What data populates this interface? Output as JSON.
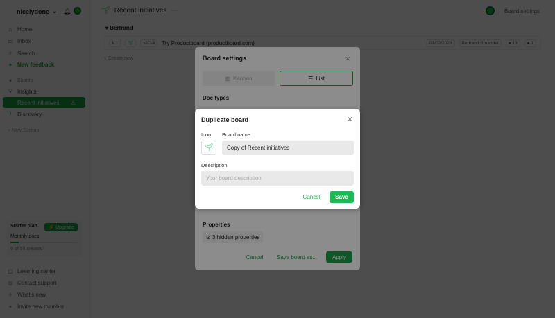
{
  "sidebar": {
    "workspace": "nicelydone",
    "items": [
      {
        "label": "Home",
        "icon": "house-icon"
      },
      {
        "label": "Inbox",
        "icon": "inbox-icon"
      },
      {
        "label": "Search",
        "icon": "search-icon"
      },
      {
        "label": "New feedback",
        "icon": "plus-icon"
      }
    ],
    "boards_label": "Boards",
    "insights": "Insights",
    "active": "Recent initiatives",
    "discovery": "Discovery",
    "new_section": "+ New Section",
    "plan": {
      "name": "Starter plan",
      "upgrade": "Upgrade",
      "docs_label": "Monthly docs",
      "progress": 0.12,
      "count": "6 of 50 created"
    },
    "footer": [
      {
        "label": "Learning center"
      },
      {
        "label": "Contact support"
      },
      {
        "label": "What's new"
      },
      {
        "label": "Invite new member"
      }
    ]
  },
  "header": {
    "title": "Recent initiatives",
    "more": "···",
    "board_settings": "Board settings"
  },
  "group": {
    "name": "Bertrand",
    "row": {
      "sub": "↳1",
      "id": "NIC-4",
      "title": "Try Productboard (productboard.com)",
      "date": "01/02/2023",
      "owner": "Bertrand Bruandet",
      "votes": "13",
      "comments": "1"
    },
    "create": "+ Create new"
  },
  "board_settings": {
    "title": "Board settings",
    "kanban": "Kanban",
    "list": "List",
    "doc_types": "Doc types",
    "properties": "Properties",
    "hidden": "3 hidden properties",
    "cancel": "Cancel",
    "save_as": "Save board as...",
    "apply": "Apply"
  },
  "duplicate": {
    "title": "Duplicate board",
    "icon_label": "Icon",
    "name_label": "Board name",
    "name_value": "Copy of Recent initiatives",
    "desc_label": "Description",
    "desc_placeholder": "Your board description",
    "cancel": "Cancel",
    "save": "Save"
  },
  "colors": {
    "accent": "#1db954"
  }
}
